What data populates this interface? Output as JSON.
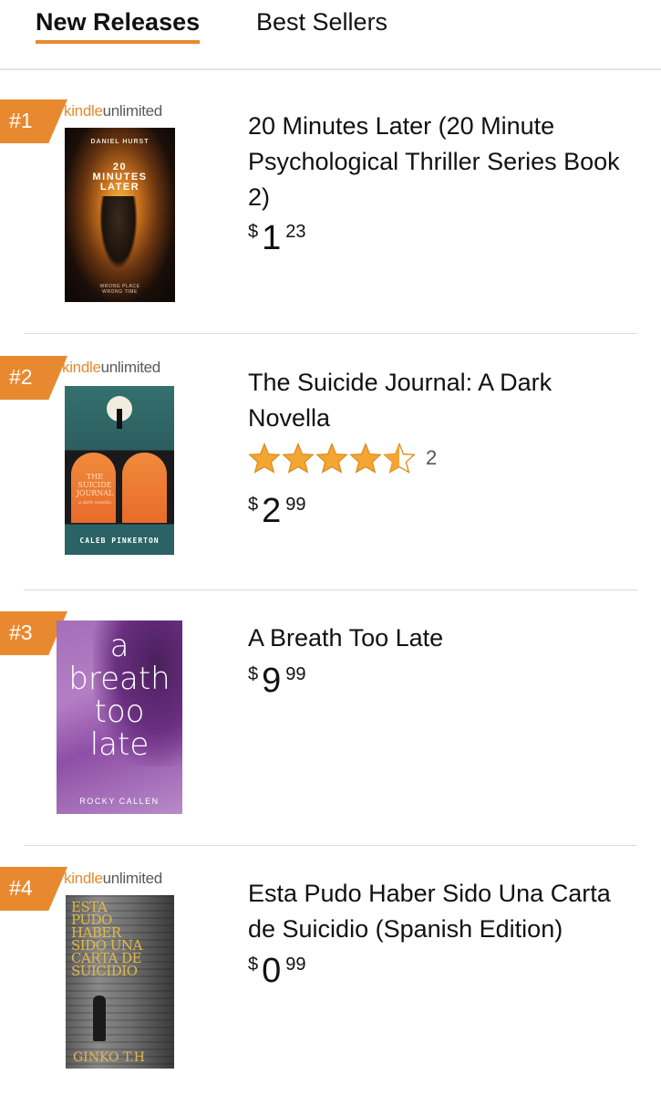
{
  "tabs": {
    "new_releases": "New Releases",
    "best_sellers": "Best Sellers"
  },
  "kindle_unlimited": {
    "kindle": "kindle",
    "unlimited": "unlimited"
  },
  "colors": {
    "accent": "#e8892f",
    "star": "#f4a532"
  },
  "items": [
    {
      "rank": "#1",
      "title": "20 Minutes Later (20 Minute Psychological Thriller Series Book 2)",
      "price": {
        "currency": "$",
        "whole": "1",
        "fraction": "23"
      },
      "cover": {
        "author": "DANIEL HURST",
        "title_lines": [
          "20",
          "MINUTES",
          "LATER"
        ],
        "tagline": "WRONG PLACE\nWRONG TIME"
      }
    },
    {
      "rank": "#2",
      "title": "The Suicide Journal: A Dark Novella",
      "rating": 4.5,
      "rating_count": "2",
      "price": {
        "currency": "$",
        "whole": "2",
        "fraction": "99"
      },
      "cover": {
        "author": "CALEB PINKERTON",
        "title_lines": [
          "THE SUICIDE",
          "JOURNAL"
        ],
        "subtitle": "a dark novella"
      }
    },
    {
      "rank": "#3",
      "title": "A Breath Too Late",
      "price": {
        "currency": "$",
        "whole": "9",
        "fraction": "99"
      },
      "cover": {
        "author": "ROCKY CALLEN",
        "title_lines": [
          "a",
          "breath",
          "too",
          "late"
        ]
      }
    },
    {
      "rank": "#4",
      "title": "Esta Pudo Haber Sido Una Carta de Suicidio (Spanish Edition)",
      "price": {
        "currency": "$",
        "whole": "0",
        "fraction": "99"
      },
      "cover": {
        "author": "GINKO T.H",
        "title_lines": [
          "ESTA",
          "PUDO",
          "HABER",
          "SIDO UNA",
          "CARTA DE",
          "SUICIDIO"
        ]
      }
    }
  ]
}
